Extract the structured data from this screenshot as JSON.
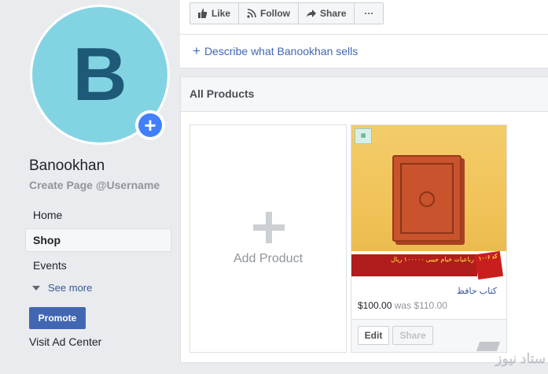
{
  "page": {
    "avatar_letter": "B",
    "name": "Banookhan",
    "username_prompt": "Create Page @Username"
  },
  "nav": {
    "items": [
      {
        "label": "Home",
        "active": false
      },
      {
        "label": "Shop",
        "active": true
      },
      {
        "label": "Events",
        "active": false
      }
    ],
    "see_more": "See more"
  },
  "sidebar": {
    "promote_label": "Promote",
    "ad_center_label": "Visit Ad Center"
  },
  "toolbar": {
    "like_label": "Like",
    "follow_label": "Follow",
    "share_label": "Share",
    "more_label": "···"
  },
  "describe": {
    "plus": "+",
    "label": "Describe what Banookhan sells"
  },
  "products": {
    "header": "All Products",
    "add_label": "Add Product",
    "items": [
      {
        "title": "کتاب حافظ",
        "price": "$100.00",
        "was_price": "was $110.00",
        "banner_text": "رباعیات خیام جیبی ۱۰۰۰۰۰ ریال",
        "badge_text": "کد ۱۰۰۶",
        "edit_label": "Edit",
        "share_label": "Share"
      }
    ]
  },
  "watermark": {
    "text": "ستاد نیوز"
  },
  "colors": {
    "accent": "#4267b2",
    "link": "#385898",
    "avatar_bg": "#83d4e3",
    "avatar_letter": "#1e5a78"
  },
  "icons": [
    "plus-circle-icon",
    "caret-down-icon",
    "thumbs-up-icon",
    "rss-icon",
    "share-arrow-icon",
    "more-dots-icon",
    "plus-icon"
  ]
}
